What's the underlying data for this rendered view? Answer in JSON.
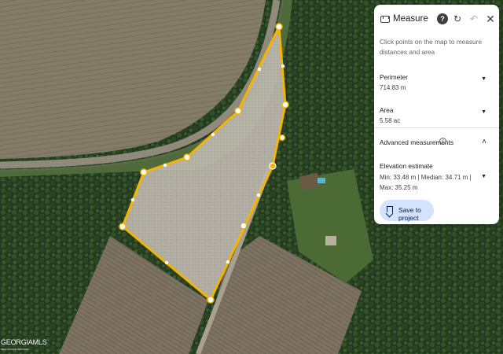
{
  "panel": {
    "title": "Measure",
    "hint": "Click points on the map to measure distances and area",
    "perimeter": {
      "label": "Perimeter",
      "value": "714.83 m"
    },
    "area": {
      "label": "Area",
      "value": "5.58 ac"
    },
    "advanced": {
      "label": "Advanced measurements"
    },
    "elevation": {
      "label": "Elevation estimate",
      "value": "Min: 33.48 m | Median: 34.71 m | Max: 35.25 m"
    },
    "save_label": "Save to project"
  },
  "icons": {
    "ruler": "ruler-icon",
    "help": "help-icon",
    "refresh": "refresh-icon",
    "undo": "undo-icon",
    "close": "close-icon",
    "chevron_down": "chevron-down-icon",
    "chevron_up": "chevron-up-icon",
    "info": "info-icon",
    "bookmark": "bookmark-icon"
  },
  "logo": {
    "text": "GEORGIAMLS",
    "subtext": "REAL ESTATE SERVICES"
  },
  "colors": {
    "outline": "#f4b400",
    "accent_button": "#d3e3fd",
    "panel_bg": "#ffffff"
  }
}
